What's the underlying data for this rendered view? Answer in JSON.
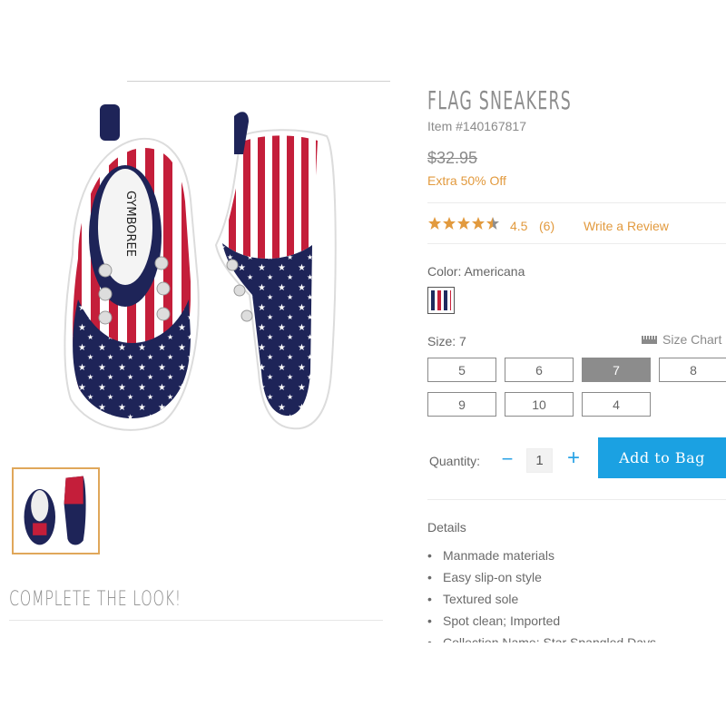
{
  "product": {
    "title": "FLAG SNEAKERS",
    "item_number": "Item #140167817",
    "price_original": "$32.95",
    "promo": "Extra 50% Off"
  },
  "rating": {
    "stars": 4.5,
    "value": "4.5",
    "count": "(6)",
    "write_review": "Write a Review",
    "star_color": "#e29a3e"
  },
  "color": {
    "label": "Color: Americana"
  },
  "size": {
    "label": "Size: 7",
    "chart_label": "Size Chart",
    "options": [
      "5",
      "6",
      "7",
      "8",
      "9",
      "10",
      "4"
    ],
    "selected": "7"
  },
  "quantity": {
    "label": "Quantity:",
    "minus": "−",
    "value": "1",
    "plus": "+"
  },
  "cart": {
    "add_label": "Add to Bag",
    "button_color": "#1ba1e2"
  },
  "details": {
    "heading": "Details",
    "items": [
      "Manmade materials",
      "Easy slip-on style",
      "Textured sole",
      "Spot clean; Imported",
      "Collection Name: Star Spangled Days"
    ]
  },
  "complete_look": {
    "heading": "COMPLETE THE LOOK!"
  },
  "brand_on_insole": "GYMBOREE"
}
